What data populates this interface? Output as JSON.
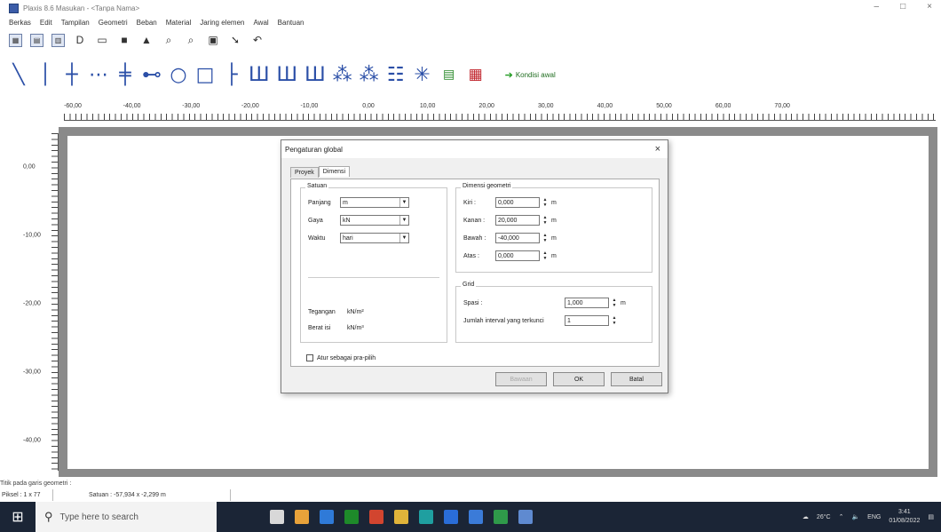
{
  "window": {
    "title": "Plaxis 8.6 Masukan - <Tanpa Nama>",
    "minimize_glyph": "–",
    "maximize_glyph": "□",
    "close_glyph": "×"
  },
  "menu": [
    "Berkas",
    "Edit",
    "Tampilan",
    "Geometri",
    "Beban",
    "Material",
    "Jaring elemen",
    "Awal",
    "Bantuan"
  ],
  "toolbar1": {
    "icons": [
      {
        "name": "new-project-icon",
        "glyph": "▦"
      },
      {
        "name": "open-project-icon",
        "glyph": "▤"
      },
      {
        "name": "save-project-icon",
        "glyph": "▥"
      },
      {
        "name": "copy-icon",
        "glyph": "D"
      },
      {
        "name": "open-folder-icon",
        "glyph": "▭"
      },
      {
        "name": "save-icon",
        "glyph": "■"
      },
      {
        "name": "print-icon",
        "glyph": "▲"
      },
      {
        "name": "zoom-in-icon",
        "glyph": "⌕"
      },
      {
        "name": "zoom-out-icon",
        "glyph": "⌕"
      },
      {
        "name": "table-icon",
        "glyph": "▣"
      },
      {
        "name": "selection-arrow-icon",
        "glyph": "➘"
      },
      {
        "name": "undo-icon",
        "glyph": "↶"
      }
    ]
  },
  "toolbar2": {
    "icons": [
      {
        "name": "geometry-line-icon",
        "glyph": "╲",
        "style": ""
      },
      {
        "name": "plate-icon",
        "glyph": "│",
        "style": ""
      },
      {
        "name": "hinge-icon",
        "glyph": "┼",
        "style": ""
      },
      {
        "name": "geogrid-icon",
        "glyph": "⋯",
        "style": ""
      },
      {
        "name": "interface-icon",
        "glyph": "╪",
        "style": ""
      },
      {
        "name": "anchor-icon",
        "glyph": "⊷",
        "style": ""
      },
      {
        "name": "tunnel-icon",
        "glyph": "○",
        "style": ""
      },
      {
        "name": "fixities-icon",
        "glyph": "□",
        "style": ""
      },
      {
        "name": "standard-fixities-icon",
        "glyph": "├",
        "style": ""
      },
      {
        "name": "load-system-a-icon",
        "glyph": "Ш",
        "style": ""
      },
      {
        "name": "load-system-b-icon",
        "glyph": "Ш",
        "style": ""
      },
      {
        "name": "point-load-a-icon",
        "glyph": "Ш",
        "style": ""
      },
      {
        "name": "prescribed-disp-a-icon",
        "glyph": "⁂",
        "style": ""
      },
      {
        "name": "prescribed-disp-b-icon",
        "glyph": "⁂",
        "style": ""
      },
      {
        "name": "drain-icon",
        "glyph": "☷",
        "style": ""
      },
      {
        "name": "well-icon",
        "glyph": "✳",
        "style": ""
      },
      {
        "name": "material-sets-icon",
        "glyph": "▤",
        "style": "green"
      },
      {
        "name": "mesh-icon",
        "glyph": "▦",
        "style": "red"
      }
    ],
    "kondisi_label": "Kondisi awal"
  },
  "hruler": {
    "labels": [
      {
        "text": "-60,00",
        "pos": 0
      },
      {
        "text": "-40,00",
        "pos": 1
      },
      {
        "text": "-30,00",
        "pos": 2
      },
      {
        "text": "-20,00",
        "pos": 3
      },
      {
        "text": "-10,00",
        "pos": 4
      },
      {
        "text": "0,00",
        "pos": 5
      },
      {
        "text": "10,00",
        "pos": 6
      },
      {
        "text": "20,00",
        "pos": 7
      },
      {
        "text": "30,00",
        "pos": 8
      },
      {
        "text": "40,00",
        "pos": 9
      },
      {
        "text": "50,00",
        "pos": 10
      },
      {
        "text": "60,00",
        "pos": 11
      },
      {
        "text": "70,00",
        "pos": 12
      }
    ]
  },
  "vruler": {
    "labels": [
      "0,00",
      "-10,00",
      "-20,00",
      "-30,00",
      "-40,00"
    ]
  },
  "status": {
    "hint": "Titik pada garis geometri :",
    "pixel": "Piksel : 1 x 77",
    "satuan": "Satuan : -57,934 x -2,299 m"
  },
  "dialog": {
    "title": "Pengaturan global",
    "close_glyph": "×",
    "tabs": [
      {
        "label": "Proyek",
        "active": false
      },
      {
        "label": "Dimensi",
        "active": true
      }
    ],
    "satuan": {
      "title": "Satuan",
      "rows": [
        {
          "label": "Panjang",
          "value": "m"
        },
        {
          "label": "Gaya",
          "value": "kN"
        },
        {
          "label": "Waktu",
          "value": "hari"
        }
      ],
      "tegangan_label": "Tegangan",
      "tegangan_unit": "kN/m²",
      "berat_label": "Berat isi",
      "berat_unit": "kN/m³"
    },
    "dimensi": {
      "title": "Dimensi geometri",
      "rows": [
        {
          "label": "Kiri :",
          "value": "0,000",
          "unit": "m"
        },
        {
          "label": "Kanan :",
          "value": "20,000",
          "unit": "m"
        },
        {
          "label": "Bawah :",
          "value": "-40,000",
          "unit": "m"
        },
        {
          "label": "Atas :",
          "value": "0,000",
          "unit": "m"
        }
      ]
    },
    "grid": {
      "title": "Grid",
      "spasi_label": "Spasi :",
      "spasi_value": "1,000",
      "spasi_unit": "m",
      "interval_label": "Jumlah interval yang terkunci",
      "interval_value": "1"
    },
    "checkbox_label": "Atur sebagai pra-pilih",
    "buttons": {
      "default": "Bawaan",
      "ok": "OK",
      "cancel": "Batal"
    }
  },
  "taskbar": {
    "search_placeholder": "Type here to search",
    "weather": "26°C",
    "lang": "ENG",
    "time": "3:41",
    "date": "01/08/2022",
    "apps": [
      "#d8d8d8",
      "#e8a23a",
      "#2f7ad8",
      "#1e8a2a",
      "#d2452f",
      "#e0b43a",
      "#1f9fa0",
      "#2a6dd8",
      "#3b7bd8",
      "#2f9a4a",
      "#5f8ad0"
    ]
  },
  "colors": {
    "canvas_frame": "#8a8a8a",
    "taskbar": "#1b2536",
    "toolbar_blue": "#2b4fa7"
  }
}
